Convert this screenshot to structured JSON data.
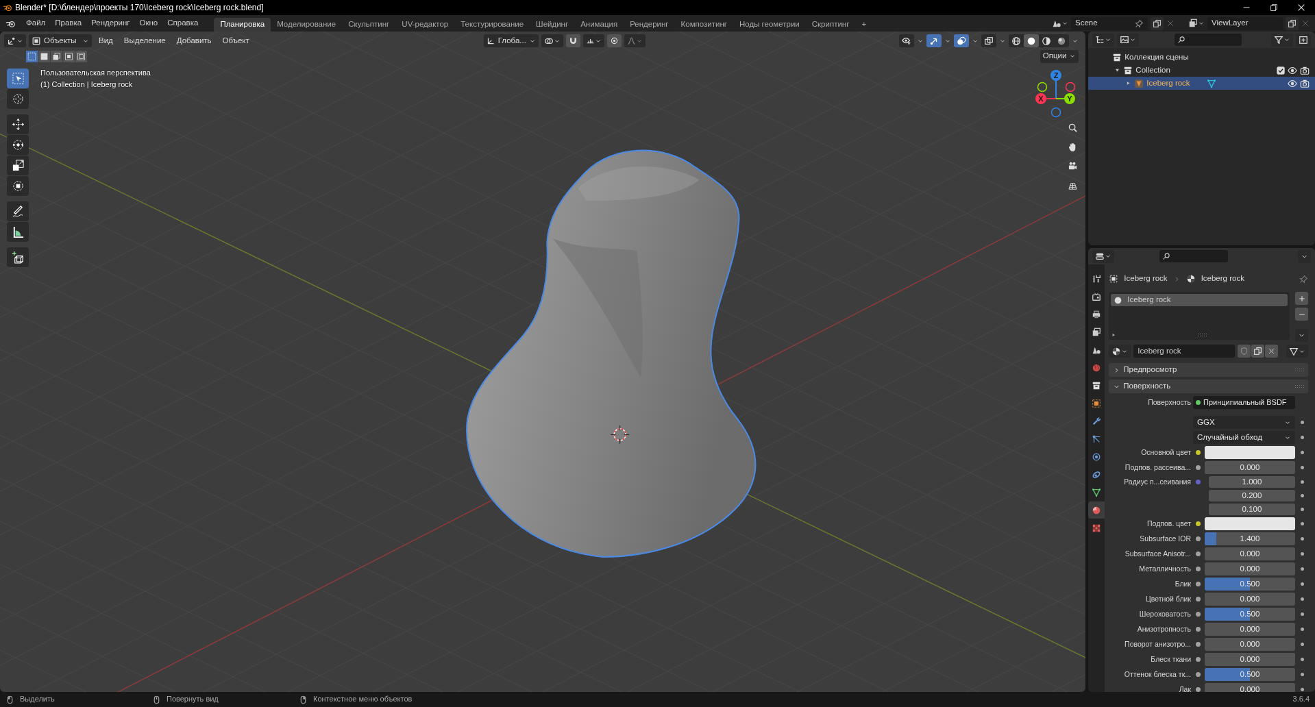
{
  "window": {
    "title": "Blender* [D:\\блендер\\проекты 170\\Iceberg rock\\Iceberg rock.blend]"
  },
  "menu": [
    "Файл",
    "Правка",
    "Рендеринг",
    "Окно",
    "Справка"
  ],
  "workspaces": [
    {
      "label": "Планировка",
      "selected": true
    },
    {
      "label": "Моделирование",
      "selected": false
    },
    {
      "label": "Скульптинг",
      "selected": false
    },
    {
      "label": "UV-редактор",
      "selected": false
    },
    {
      "label": "Текстурирование",
      "selected": false
    },
    {
      "label": "Шейдинг",
      "selected": false
    },
    {
      "label": "Анимация",
      "selected": false
    },
    {
      "label": "Рендеринг",
      "selected": false
    },
    {
      "label": "Композитинг",
      "selected": false
    },
    {
      "label": "Ноды геометрии",
      "selected": false
    },
    {
      "label": "Скриптинг",
      "selected": false
    }
  ],
  "add_workspace": "+",
  "scene": "Scene",
  "view_layer": "ViewLayer",
  "viewport": {
    "mode": "Объекты",
    "menus": [
      "Вид",
      "Выделение",
      "Добавить",
      "Объект"
    ],
    "orientation": "Глоба...",
    "options": "Опции",
    "select_modes": [
      {
        "selected": true
      },
      {
        "selected": false
      },
      {
        "selected": false
      },
      {
        "selected": false
      },
      {
        "selected": false
      }
    ],
    "toggles": [
      {
        "kind": "selectability",
        "on": false
      },
      {
        "kind": "gizmos",
        "on": true
      },
      {
        "kind": "overlays",
        "on": true
      },
      {
        "kind": "xray",
        "on": false
      }
    ],
    "shading": [
      {
        "kind": "wireframe",
        "selected": false
      },
      {
        "kind": "solid",
        "selected": true
      },
      {
        "kind": "material",
        "selected": false
      },
      {
        "kind": "rendered",
        "selected": false
      }
    ],
    "info": [
      "Пользовательская перспектива",
      "(1) Collection | Iceberg rock"
    ],
    "tool_groups": [
      {
        "tools": [
          {
            "kind": "select",
            "selected": true
          },
          {
            "kind": "cursor",
            "selected": false
          }
        ]
      },
      {
        "tools": [
          {
            "kind": "move",
            "selected": false
          },
          {
            "kind": "rotate",
            "selected": false
          },
          {
            "kind": "scale",
            "selected": false
          },
          {
            "kind": "transform",
            "selected": false
          }
        ]
      },
      {
        "tools": [
          {
            "kind": "annotate",
            "selected": false
          },
          {
            "kind": "measure",
            "selected": false
          }
        ]
      },
      {
        "tools": [
          {
            "kind": "add-cube",
            "selected": false
          }
        ]
      }
    ],
    "gizmo": [
      {
        "label": "Z",
        "color": "#2f83e3"
      },
      {
        "label": "Y",
        "color": "#8bdc00"
      },
      {
        "label": "X",
        "color": "#ff3352"
      }
    ]
  },
  "outliner": {
    "tree": [
      {
        "label": "Коллекция сцены",
        "kind": "scene",
        "selected": false,
        "children": [
          {
            "label": "Collection",
            "kind": "collection",
            "expanded": true,
            "selected": false,
            "checked": true,
            "children": [
              {
                "label": "Iceberg rock",
                "kind": "object",
                "expanded": false,
                "selected": true
              }
            ]
          }
        ]
      }
    ]
  },
  "properties": {
    "tabs": [
      {
        "kind": "tool",
        "selected": false
      },
      {
        "kind": "render",
        "selected": false
      },
      {
        "kind": "output",
        "selected": false
      },
      {
        "kind": "view_layer",
        "selected": false
      },
      {
        "kind": "scene",
        "selected": false
      },
      {
        "kind": "world",
        "selected": false
      },
      {
        "kind": "collection",
        "selected": false
      },
      {
        "kind": "object",
        "selected": false
      },
      {
        "kind": "modifiers",
        "selected": false
      },
      {
        "kind": "particles",
        "selected": false
      },
      {
        "kind": "physics",
        "selected": false
      },
      {
        "kind": "constraints",
        "selected": false
      },
      {
        "kind": "data",
        "selected": false
      },
      {
        "kind": "material",
        "selected": true
      },
      {
        "kind": "texture",
        "selected": false
      }
    ],
    "breadcrumb": [
      "Iceberg rock",
      "Iceberg rock"
    ],
    "slots": [
      {
        "label": "Iceberg rock",
        "selected": true
      }
    ],
    "material": "Iceberg rock",
    "panels": [
      {
        "label": "Предпросмотр",
        "expanded": false
      },
      {
        "label": "Поверхность",
        "expanded": true,
        "fields": [
          {
            "kind": "shader",
            "label": "Поверхность",
            "value": "Принципиальный BSDF"
          },
          {
            "kind": "dropdown",
            "value": "GGX"
          },
          {
            "kind": "dropdown",
            "value": "Случайный обход"
          },
          {
            "kind": "color",
            "label": "Основной цвет",
            "color": "#e6e6e6"
          },
          {
            "kind": "number",
            "label": "Подпов. рассеива...",
            "value": "0.000"
          },
          {
            "kind": "vector",
            "label": "Радиус п...сеивания",
            "values": [
              "1.000",
              "0.200",
              "0.100"
            ]
          },
          {
            "kind": "color",
            "label": "Подпов. цвет",
            "color": "#e6e6e6"
          },
          {
            "kind": "number",
            "label": "Subsurface IOR",
            "value": "1.400",
            "level": 0.13
          },
          {
            "kind": "number",
            "label": "Subsurface Anisotr...",
            "value": "0.000"
          },
          {
            "kind": "number",
            "label": "Металличность",
            "value": "0.000"
          },
          {
            "kind": "number",
            "label": "Блик",
            "value": "0.500",
            "level": 0.5
          },
          {
            "kind": "number",
            "label": "Цветной блик",
            "value": "0.000"
          },
          {
            "kind": "number",
            "label": "Шероховатость",
            "value": "0.500",
            "level": 0.5
          },
          {
            "kind": "number",
            "label": "Анизотропность",
            "value": "0.000"
          },
          {
            "kind": "number",
            "label": "Поворот анизотро...",
            "value": "0.000"
          },
          {
            "kind": "number",
            "label": "Блеск ткани",
            "value": "0.000"
          },
          {
            "kind": "number",
            "label": "Оттенок блеска тк...",
            "value": "0.500",
            "level": 0.5
          },
          {
            "kind": "number",
            "label": "Лак",
            "value": "0.000"
          }
        ]
      }
    ]
  },
  "status_bar": {
    "hints": [
      {
        "kind": "left",
        "label": "Выделить"
      },
      {
        "kind": "middle",
        "label": "Повернуть вид"
      },
      {
        "kind": "right",
        "label": "Контекстное меню объектов"
      }
    ],
    "version": "3.6.4"
  }
}
